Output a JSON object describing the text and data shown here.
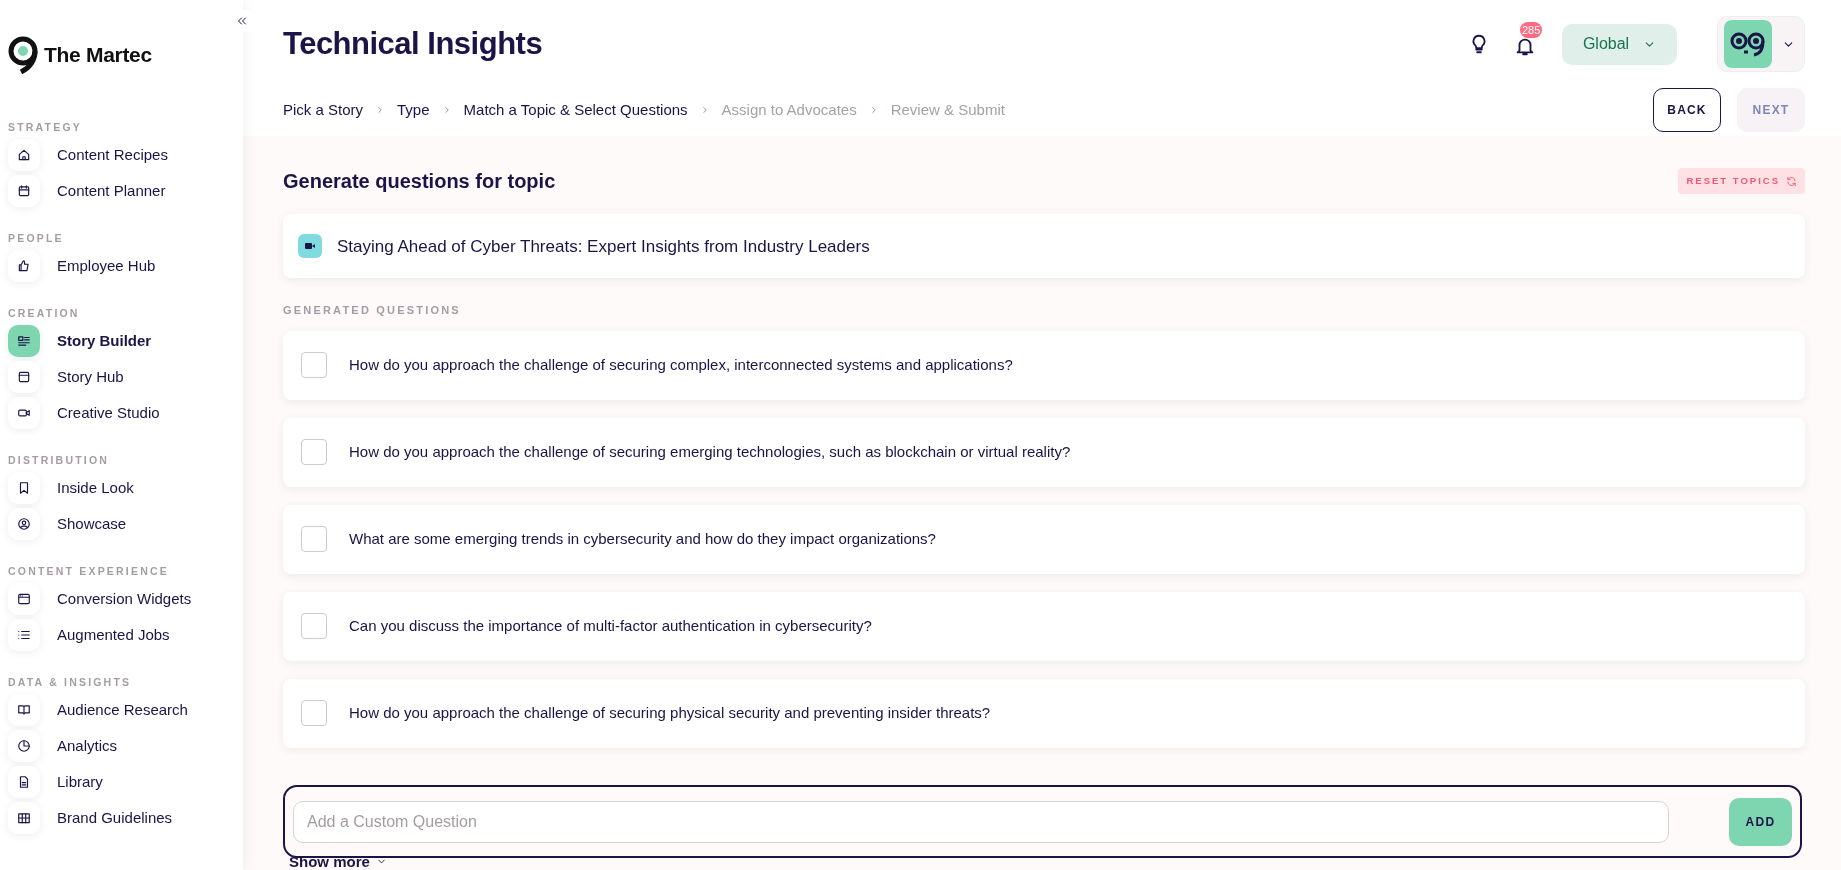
{
  "brand": {
    "name": "The Martec"
  },
  "sidebar": {
    "sections": [
      {
        "label": "STRATEGY",
        "items": [
          {
            "label": "Content Recipes",
            "selected": false
          },
          {
            "label": "Content Planner",
            "selected": false
          }
        ]
      },
      {
        "label": "PEOPLE",
        "items": [
          {
            "label": "Employee Hub",
            "selected": false
          }
        ]
      },
      {
        "label": "CREATION",
        "items": [
          {
            "label": "Story Builder",
            "selected": true
          },
          {
            "label": "Story Hub",
            "selected": false
          },
          {
            "label": "Creative Studio",
            "selected": false
          }
        ]
      },
      {
        "label": "DISTRIBUTION",
        "items": [
          {
            "label": "Inside Look",
            "selected": false
          },
          {
            "label": "Showcase",
            "selected": false
          }
        ]
      },
      {
        "label": "CONTENT EXPERIENCE",
        "items": [
          {
            "label": "Conversion Widgets",
            "selected": false
          },
          {
            "label": "Augmented Jobs",
            "selected": false
          }
        ]
      },
      {
        "label": "DATA & INSIGHTS",
        "items": [
          {
            "label": "Audience Research",
            "selected": false
          },
          {
            "label": "Analytics",
            "selected": false
          },
          {
            "label": "Library",
            "selected": false
          },
          {
            "label": "Brand Guidelines",
            "selected": false
          }
        ]
      }
    ]
  },
  "header": {
    "title": "Technical Insights",
    "notification_count": "285",
    "region": "Global"
  },
  "steps": [
    {
      "label": "Pick a Story",
      "disabled": false
    },
    {
      "label": "Type",
      "disabled": false
    },
    {
      "label": "Match a Topic & Select Questions",
      "disabled": false
    },
    {
      "label": "Assign to Advocates",
      "disabled": true
    },
    {
      "label": "Review & Submit",
      "disabled": true
    }
  ],
  "nav_buttons": [
    {
      "label": "BACK",
      "disabled": false
    },
    {
      "label": "NEXT",
      "disabled": true
    }
  ],
  "section_title": "Generate questions for topic",
  "reset_button": "RESET TOPICS",
  "topic": "Staying Ahead of Cyber Threats: Expert Insights from Industry Leaders",
  "questions_label": "GENERATED QUESTIONS",
  "questions": [
    {
      "text": "How do you approach the challenge of securing complex, interconnected systems and applications?",
      "checked": false
    },
    {
      "text": "How do you approach the challenge of securing emerging technologies, such as blockchain or virtual reality?",
      "checked": false
    },
    {
      "text": "What are some emerging trends in cybersecurity and how do they impact organizations?",
      "checked": false
    },
    {
      "text": "Can you discuss the importance of multi-factor authentication in cybersecurity?",
      "checked": false
    },
    {
      "text": "How do you approach the challenge of securing physical security and preventing insider threats?",
      "checked": false
    }
  ],
  "custom_question": {
    "placeholder": "Add a Custom Question",
    "button": "ADD"
  },
  "show_more": "Show more"
}
